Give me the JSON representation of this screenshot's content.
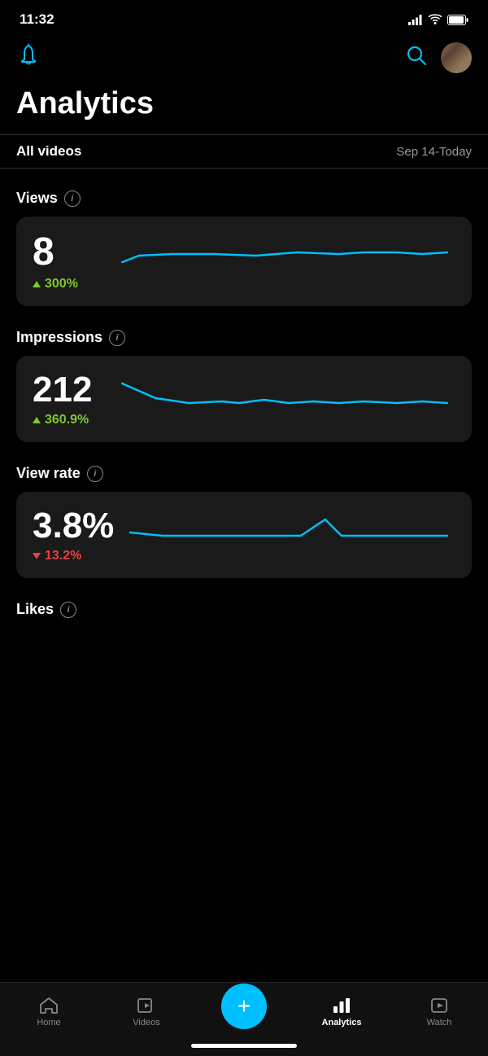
{
  "statusBar": {
    "time": "11:32"
  },
  "header": {
    "bellLabel": "🔔",
    "searchLabel": "🔍"
  },
  "pageTitle": "Analytics",
  "filter": {
    "allVideos": "All videos",
    "dateRange": "Sep 14-Today"
  },
  "metrics": [
    {
      "id": "views",
      "label": "Views",
      "value": "8",
      "change": "300%",
      "direction": "up",
      "chartPoints": "160,50 180,42 220,40 270,40 320,42 370,38 420,40 450,38 490,38 520,40 550,38"
    },
    {
      "id": "impressions",
      "label": "Impressions",
      "value": "212",
      "change": "360.9%",
      "direction": "up",
      "chartPoints": "160,20 200,38 240,44 280,42 300,44 330,40 360,44 390,42 420,44 450,42 490,44 520,42 550,44"
    },
    {
      "id": "viewrate",
      "label": "View rate",
      "value": "3.8%",
      "change": "13.2%",
      "direction": "down",
      "chartPoints": "160,46 200,50 240,50 300,50 340,50 370,50 400,30 420,50 450,50 490,50 520,50 550,50"
    }
  ],
  "likesSection": {
    "label": "Likes"
  },
  "bottomNav": {
    "items": [
      {
        "id": "home",
        "label": "Home",
        "active": false,
        "icon": "home"
      },
      {
        "id": "videos",
        "label": "Videos",
        "active": false,
        "icon": "videos"
      },
      {
        "id": "add",
        "label": "",
        "active": false,
        "icon": "plus"
      },
      {
        "id": "analytics",
        "label": "Analytics",
        "active": true,
        "icon": "analytics"
      },
      {
        "id": "watch",
        "label": "Watch",
        "active": false,
        "icon": "watch"
      }
    ]
  }
}
